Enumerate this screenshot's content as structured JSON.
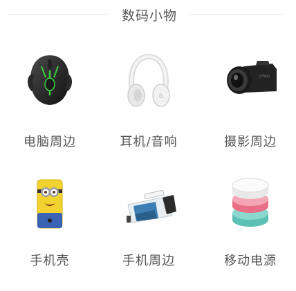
{
  "section": {
    "title": "数码小物"
  },
  "categories": [
    {
      "label": "电脑周边",
      "icon": "gaming-mouse-icon"
    },
    {
      "label": "耳机/音响",
      "icon": "headphones-icon"
    },
    {
      "label": "摄影周边",
      "icon": "camera-lens-icon"
    },
    {
      "label": "手机壳",
      "icon": "phone-case-icon"
    },
    {
      "label": "手机周边",
      "icon": "phone-lens-clip-icon"
    },
    {
      "label": "移动电源",
      "icon": "power-bank-icon"
    }
  ],
  "colors": {
    "text": "#555555",
    "divider": "#e6e6e6",
    "background": "#ffffff"
  }
}
